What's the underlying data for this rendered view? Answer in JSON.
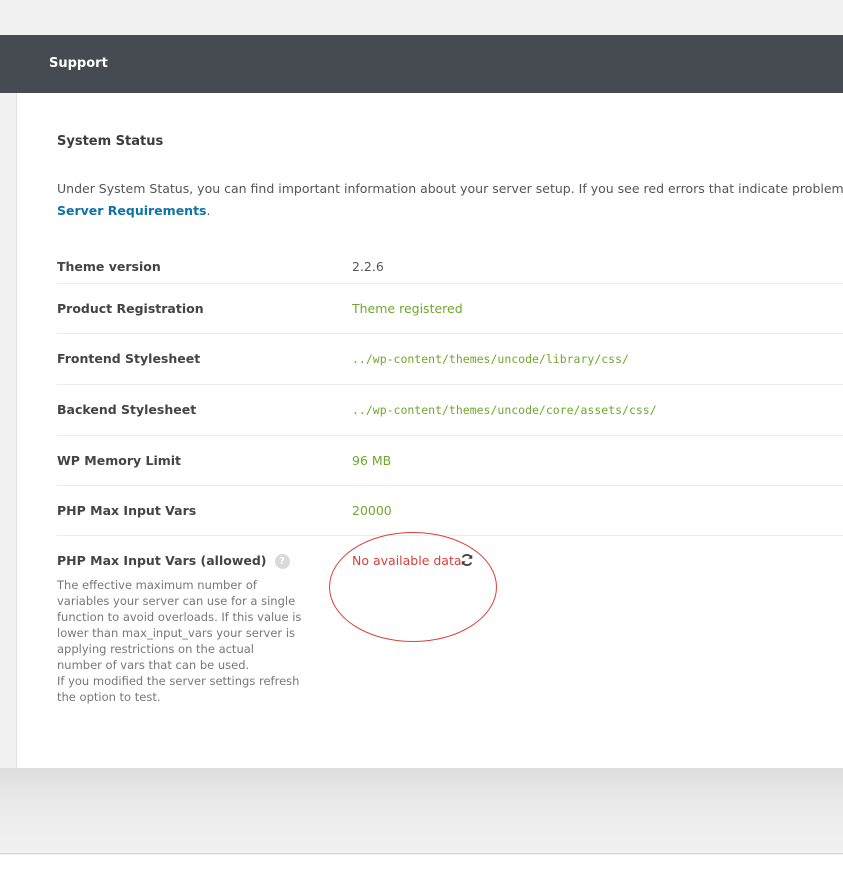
{
  "header": {
    "title": "Support"
  },
  "section": {
    "title": "System Status",
    "intro_text": "Under System Status, you can find important information about your server setup. If you see red errors that indicate problems, likely, you'",
    "intro_link": "Server Requirements",
    "intro_after_link": "."
  },
  "rows": [
    {
      "label": "Theme version",
      "value": "2.2.6"
    },
    {
      "label": "Product Registration",
      "value": "Theme registered"
    },
    {
      "label": "Frontend Stylesheet",
      "value": "../wp-content/themes/uncode/library/css/"
    },
    {
      "label": "Backend Stylesheet",
      "value": "../wp-content/themes/uncode/core/assets/css/"
    },
    {
      "label": "WP Memory Limit",
      "value": "96 MB"
    },
    {
      "label": "PHP Max Input Vars",
      "value": "20000"
    }
  ],
  "allowed_row": {
    "label": "PHP Max Input Vars (allowed)",
    "help_glyph": "?",
    "description_1": "The effective maximum number of variables your server can use for a single function to avoid overloads. If this value is lower than max_input_vars your server is applying restrictions on the actual number of vars that can be used.",
    "description_2": "If you modified the server settings refresh the option to test.",
    "value": "No available data",
    "refresh_icon": "refresh-icon"
  },
  "colors": {
    "header_bg": "#464b52",
    "ok_green": "#6fa82c",
    "error_red": "#d9403a",
    "link_blue": "#0f72a8"
  }
}
